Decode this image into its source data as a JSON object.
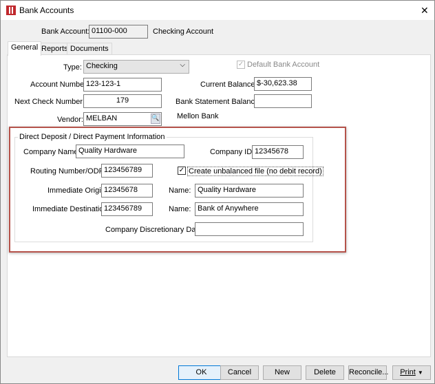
{
  "window": {
    "title": "Bank Accounts",
    "close": "✕"
  },
  "header": {
    "bank_account_label": "Bank Account:",
    "bank_account": "01100-000",
    "account_name": "Checking Account"
  },
  "tabs": [
    "General",
    "Reports",
    "Documents"
  ],
  "general": {
    "type_label": "Type:",
    "type": "Checking",
    "default_label": "Default Bank Account",
    "account_number_label": "Account Number:",
    "account_number": "123-123-1",
    "current_balance_label": "Current Balance:",
    "current_balance": "$-30,623.38",
    "next_check_label": "Next Check Number:",
    "next_check": "179",
    "statement_balance_label": "Bank Statement Balance:",
    "statement_balance": "",
    "vendor_label": "Vendor:",
    "vendor": "MELBAN",
    "vendor_name": "Mellon Bank"
  },
  "direct_deposit": {
    "title": "Direct Deposit / Direct Payment Information",
    "company_name_label": "Company Name:",
    "company_name": "Quality Hardware",
    "company_id_label": "Company ID:",
    "company_id": "12345678",
    "routing_label": "Routing Number/ODFI:",
    "routing": "123456789",
    "unbalanced_label": "Create unbalanced file (no debit record)",
    "unbalanced_checked": true,
    "origin_label": "Immediate Origin:",
    "origin": "12345678",
    "origin_name_label": "Name:",
    "origin_name": "Quality Hardware",
    "destination_label": "Immediate Destination:",
    "destination": "123456789",
    "destination_name_label": "Name:",
    "destination_name": "Bank of Anywhere",
    "discretionary_label": "Company Discretionary Data:",
    "discretionary": ""
  },
  "buttons": {
    "ok": "OK",
    "cancel": "Cancel",
    "new": "New",
    "delete": "Delete",
    "reconcile": "Reconcile...",
    "print": "Print"
  },
  "colors": {
    "highlight": "#b5524a",
    "app_icon": "#c0282d"
  }
}
